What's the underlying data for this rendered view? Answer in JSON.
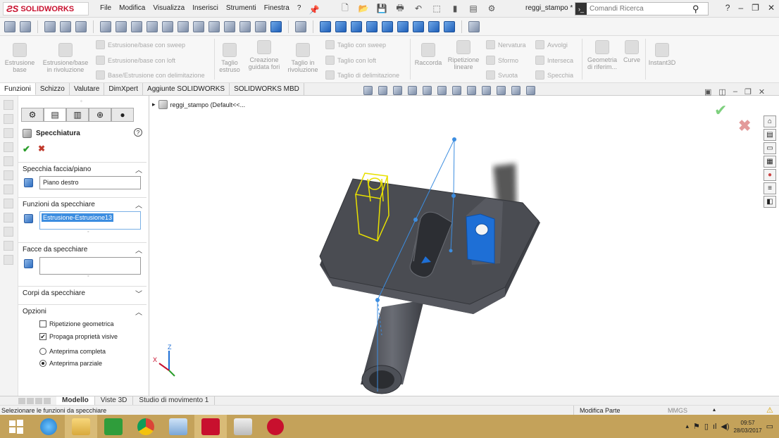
{
  "app": {
    "logo_text": "SOLIDWORKS",
    "menus": [
      "File",
      "Modifica",
      "Visualizza",
      "Inserisci",
      "Strumenti",
      "Finestra",
      "?"
    ],
    "doc_title": "reggi_stampo *",
    "search_placeholder": "Comandi Ricerca"
  },
  "ribbon": {
    "estrusione_base": "Estrusione\nbase",
    "estrusione_rivoluzione": "Estrusione/base\nin rivoluzione",
    "sweep": "Estrusione/base con sweep",
    "loft": "Estrusione/base con loft",
    "delimitazione": "Base/Estrusione con delimitazione",
    "taglio_estruso": "Taglio\nestruso",
    "creazione_fori": "Creazione\nguidata fori",
    "taglio_rivoluzione": "Taglio in\nrivoluzione",
    "taglio_sweep": "Taglio con sweep",
    "taglio_loft": "Taglio con loft",
    "taglio_delimitazione": "Taglio di delimitazione",
    "raccorda": "Raccorda",
    "ripetizione_lineare": "Ripetizione\nlineare",
    "nervatura": "Nervatura",
    "sformo": "Sformo",
    "svuota": "Svuota",
    "avvolgi": "Avvolgi",
    "interseca": "Interseca",
    "specchia": "Specchia",
    "geometria": "Geometria\ndi riferim...",
    "curve": "Curve",
    "instant3d": "Instant3D"
  },
  "command_tabs": [
    "Funzioni",
    "Schizzo",
    "Valutare",
    "DimXpert",
    "Aggiunte SOLIDWORKS",
    "SOLIDWORKS MBD"
  ],
  "panel": {
    "title": "Specchiatura",
    "sections": {
      "faccia_piano": "Specchia faccia/piano",
      "faccia_piano_value": "Piano destro",
      "funzioni": "Funzioni da specchiare",
      "funzioni_value": "Estrusione-Estrusione13",
      "facce": "Facce da specchiare",
      "corpi": "Corpi da specchiare",
      "opzioni": "Opzioni"
    },
    "options": {
      "ripetizione_geometrica": "Ripetizione geometrica",
      "ripetizione_geometrica_checked": false,
      "propaga": "Propaga proprietà visive",
      "propaga_checked": true,
      "anteprima_completa": "Anteprima completa",
      "anteprima_parziale": "Anteprima parziale",
      "anteprima_selected": "Anteprima parziale"
    }
  },
  "tree": {
    "root_label": "reggi_stampo  (Default<<..."
  },
  "bottom_tabs": [
    "Modello",
    "Viste 3D",
    "Studio di movimento 1"
  ],
  "status": {
    "message": "Selezionare le funzioni da specchiare",
    "mode": "Modifica Parte",
    "units": "MMGS"
  },
  "taskbar": {
    "time": "09:57",
    "date": "28/03/2017"
  },
  "colors": {
    "selection_blue": "#3c8de0",
    "preview_yellow": "#e8e000",
    "part_gray": "#55575e",
    "taskbar": "#c4a25a"
  }
}
